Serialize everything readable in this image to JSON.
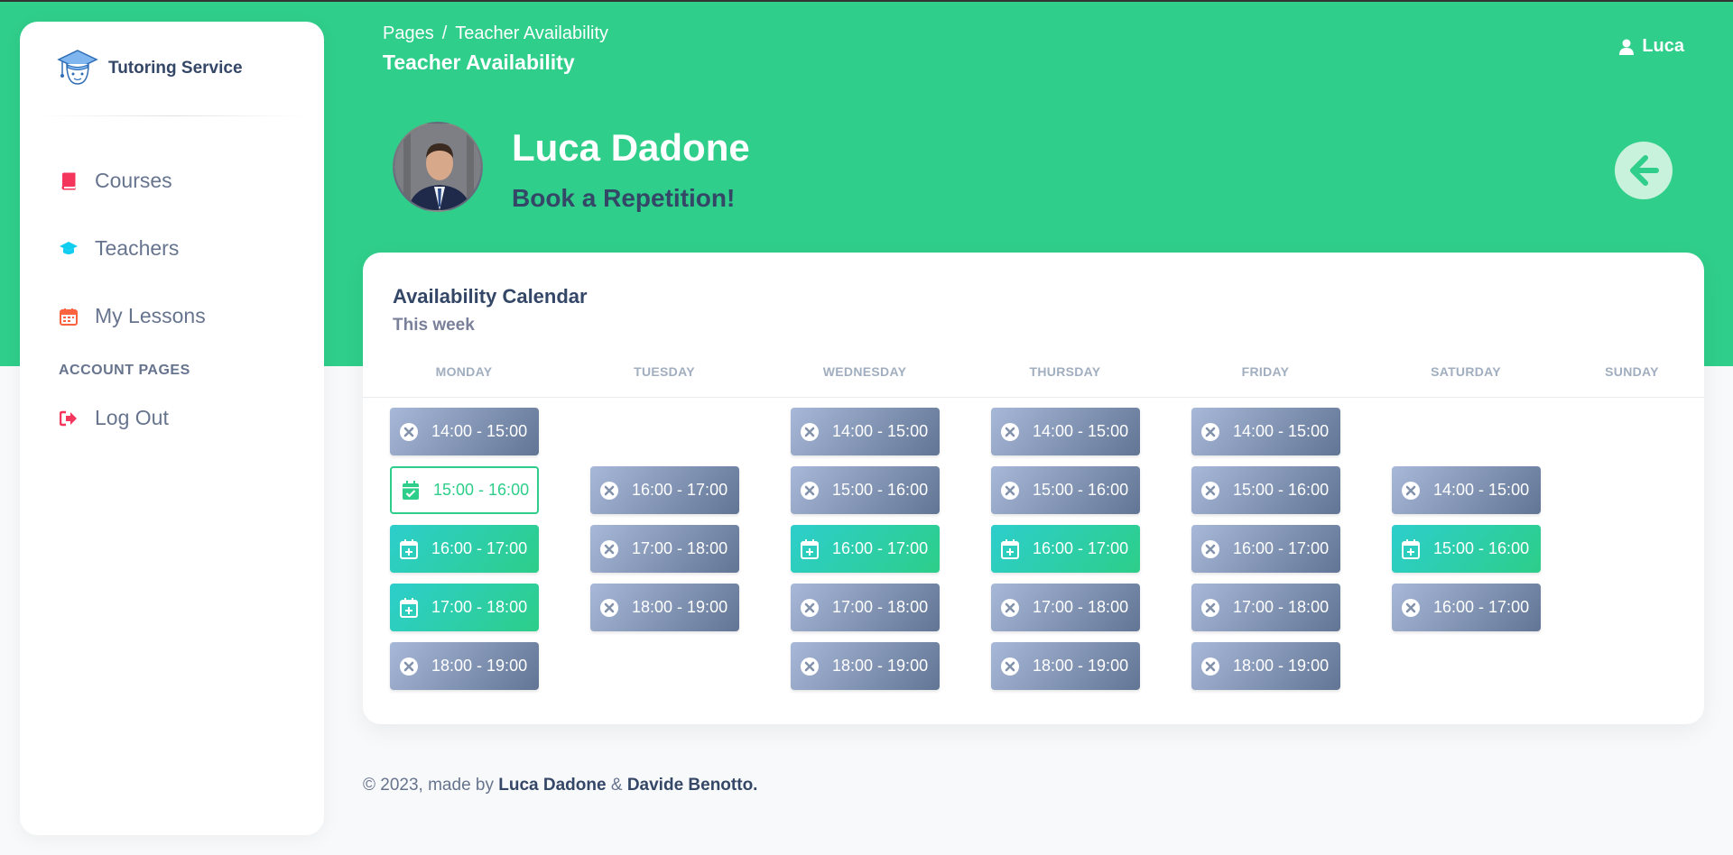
{
  "sidebar": {
    "brand": "Tutoring Service",
    "items": [
      {
        "label": "Courses",
        "icon": "book-icon",
        "color": "#f5365c"
      },
      {
        "label": "Teachers",
        "icon": "graduation-cap-icon",
        "color": "#11cdef"
      },
      {
        "label": "My Lessons",
        "icon": "calendar-icon",
        "color": "#fb6340"
      }
    ],
    "section_title": "ACCOUNT PAGES",
    "logout": {
      "label": "Log Out",
      "icon": "sign-out-icon"
    }
  },
  "header": {
    "breadcrumb_root": "Pages",
    "breadcrumb_sep": "/",
    "breadcrumb_current": "Teacher Availability",
    "title": "Teacher Availability",
    "user": "Luca"
  },
  "profile": {
    "name": "Luca Dadone",
    "subtitle": "Book a Repetition!"
  },
  "calendar": {
    "title": "Availability Calendar",
    "subtitle": "This week",
    "days": [
      "MONDAY",
      "TUESDAY",
      "WEDNESDAY",
      "THURSDAY",
      "FRIDAY",
      "SATURDAY",
      "SUNDAY"
    ],
    "slots": [
      {
        "day": 0,
        "row": 0,
        "time": "14:00 - 15:00",
        "status": "unavailable"
      },
      {
        "day": 0,
        "row": 1,
        "time": "15:00 - 16:00",
        "status": "booked"
      },
      {
        "day": 0,
        "row": 2,
        "time": "16:00 - 17:00",
        "status": "available"
      },
      {
        "day": 0,
        "row": 3,
        "time": "17:00 - 18:00",
        "status": "available"
      },
      {
        "day": 0,
        "row": 4,
        "time": "18:00 - 19:00",
        "status": "unavailable"
      },
      {
        "day": 1,
        "row": 1,
        "time": "16:00 - 17:00",
        "status": "unavailable"
      },
      {
        "day": 1,
        "row": 2,
        "time": "17:00 - 18:00",
        "status": "unavailable"
      },
      {
        "day": 1,
        "row": 3,
        "time": "18:00 - 19:00",
        "status": "unavailable"
      },
      {
        "day": 2,
        "row": 0,
        "time": "14:00 - 15:00",
        "status": "unavailable"
      },
      {
        "day": 2,
        "row": 1,
        "time": "15:00 - 16:00",
        "status": "unavailable"
      },
      {
        "day": 2,
        "row": 2,
        "time": "16:00 - 17:00",
        "status": "available"
      },
      {
        "day": 2,
        "row": 3,
        "time": "17:00 - 18:00",
        "status": "unavailable"
      },
      {
        "day": 2,
        "row": 4,
        "time": "18:00 - 19:00",
        "status": "unavailable"
      },
      {
        "day": 3,
        "row": 0,
        "time": "14:00 - 15:00",
        "status": "unavailable"
      },
      {
        "day": 3,
        "row": 1,
        "time": "15:00 - 16:00",
        "status": "unavailable"
      },
      {
        "day": 3,
        "row": 2,
        "time": "16:00 - 17:00",
        "status": "available"
      },
      {
        "day": 3,
        "row": 3,
        "time": "17:00 - 18:00",
        "status": "unavailable"
      },
      {
        "day": 3,
        "row": 4,
        "time": "18:00 - 19:00",
        "status": "unavailable"
      },
      {
        "day": 4,
        "row": 0,
        "time": "14:00 - 15:00",
        "status": "unavailable"
      },
      {
        "day": 4,
        "row": 1,
        "time": "15:00 - 16:00",
        "status": "unavailable"
      },
      {
        "day": 4,
        "row": 2,
        "time": "16:00 - 17:00",
        "status": "unavailable"
      },
      {
        "day": 4,
        "row": 3,
        "time": "17:00 - 18:00",
        "status": "unavailable"
      },
      {
        "day": 4,
        "row": 4,
        "time": "18:00 - 19:00",
        "status": "unavailable"
      },
      {
        "day": 5,
        "row": 1,
        "time": "14:00 - 15:00",
        "status": "unavailable"
      },
      {
        "day": 5,
        "row": 2,
        "time": "15:00 - 16:00",
        "status": "available"
      },
      {
        "day": 5,
        "row": 3,
        "time": "16:00 - 17:00",
        "status": "unavailable"
      }
    ]
  },
  "footer": {
    "prefix": "© 2023, made by",
    "author1": "Luca Dadone",
    "amp": "&",
    "author2": "Davide Benotto."
  },
  "colors": {
    "accent": "#2fce8a",
    "available": "#2dce89",
    "unavailable": "#8392ab"
  }
}
